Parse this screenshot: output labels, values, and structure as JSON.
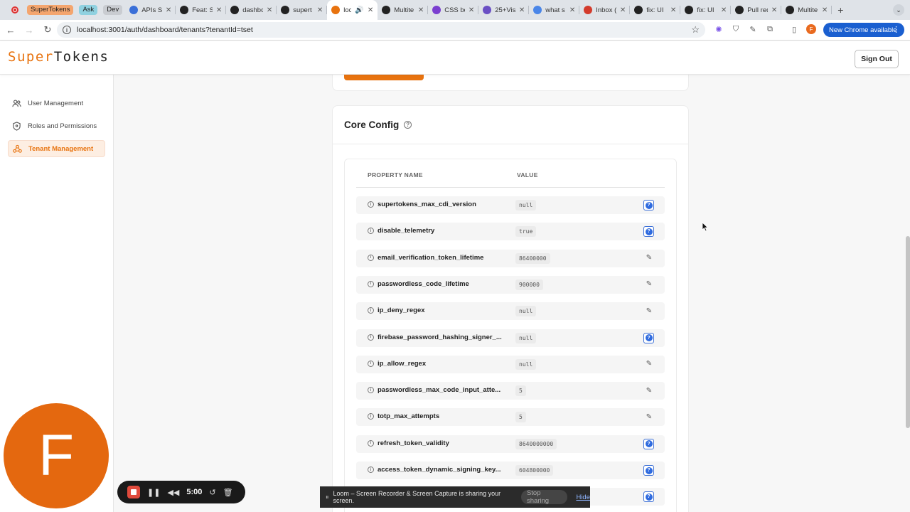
{
  "browser": {
    "tab_groups": [
      {
        "label": "SuperTokens",
        "color": "#f4a56e"
      },
      {
        "label": "Ask",
        "color": "#8fd1e0"
      },
      {
        "label": "Dev",
        "color": "#c9ccd1"
      }
    ],
    "tabs": [
      {
        "label": "APIs Sp",
        "icon": "doc-icon",
        "color": "#3a6fd8"
      },
      {
        "label": "Feat: S",
        "icon": "github-icon",
        "color": "#222222"
      },
      {
        "label": "dashbo",
        "icon": "github-icon",
        "color": "#222222"
      },
      {
        "label": "supert",
        "icon": "github-icon",
        "color": "#222222"
      },
      {
        "label": "loc",
        "icon": "supertokens-icon",
        "color": "#e8730f",
        "active": true
      },
      {
        "label": "Multite",
        "icon": "github-icon",
        "color": "#222222"
      },
      {
        "label": "CSS bo",
        "icon": "css-icon",
        "color": "#7b3fd0"
      },
      {
        "label": "25+Vis",
        "icon": "feather-icon",
        "color": "#6a4fc4"
      },
      {
        "label": "what s",
        "icon": "google-icon",
        "color": "#4a86e8"
      },
      {
        "label": "Inbox (",
        "icon": "gmail-icon",
        "color": "#d33b2c"
      },
      {
        "label": "fix: UI",
        "icon": "github-icon",
        "color": "#222222"
      },
      {
        "label": "fix: UI",
        "icon": "github-icon",
        "color": "#222222"
      },
      {
        "label": "Pull req",
        "icon": "github-icon",
        "color": "#222222"
      },
      {
        "label": "Multite",
        "icon": "github-icon",
        "color": "#222222"
      }
    ],
    "new_tab_symbol": "+",
    "url": "localhost:3001/auth/dashboard/tenants?tenantId=tset",
    "profile_initial": "F",
    "update_button": "New Chrome available"
  },
  "header": {
    "logo_super": "Super",
    "logo_tokens": "Tokens",
    "sign_out": "Sign Out"
  },
  "sidebar": {
    "items": [
      {
        "label": "User Management",
        "icon": "users-icon"
      },
      {
        "label": "Roles and Permissions",
        "icon": "shield-icon"
      },
      {
        "label": "Tenant Management",
        "icon": "tenant-icon",
        "active": true
      }
    ]
  },
  "core_config": {
    "title": "Core Config",
    "columns": [
      "PROPERTY NAME",
      "VALUE"
    ],
    "rows": [
      {
        "name": "supertokens_max_cdi_version",
        "value": "null",
        "action": "help"
      },
      {
        "name": "disable_telemetry",
        "value": "true",
        "action": "help"
      },
      {
        "name": "email_verification_token_lifetime",
        "value": "86400000",
        "action": "edit"
      },
      {
        "name": "passwordless_code_lifetime",
        "value": "900000",
        "action": "edit"
      },
      {
        "name": "ip_deny_regex",
        "value": "null",
        "action": "edit"
      },
      {
        "name": "firebase_password_hashing_signer_...",
        "value": "null",
        "action": "help"
      },
      {
        "name": "ip_allow_regex",
        "value": "null",
        "action": "edit"
      },
      {
        "name": "passwordless_max_code_input_atte...",
        "value": "5",
        "action": "edit"
      },
      {
        "name": "totp_max_attempts",
        "value": "5",
        "action": "edit"
      },
      {
        "name": "refresh_token_validity",
        "value": "8640000000",
        "action": "help"
      },
      {
        "name": "access_token_dynamic_signing_key...",
        "value": "604800000",
        "action": "help"
      },
      {
        "name": "",
        "value": "",
        "action": "help"
      }
    ]
  },
  "loom": {
    "avatar_initial": "F",
    "timer": "5:00",
    "share_message": "Loom – Screen Recorder & Screen Capture is sharing your screen.",
    "stop_sharing": "Stop sharing",
    "hide": "Hide"
  },
  "colors": {
    "brand_orange": "#e8730f",
    "help_blue": "#2f6bdf",
    "loom_orange": "#e4680f"
  }
}
